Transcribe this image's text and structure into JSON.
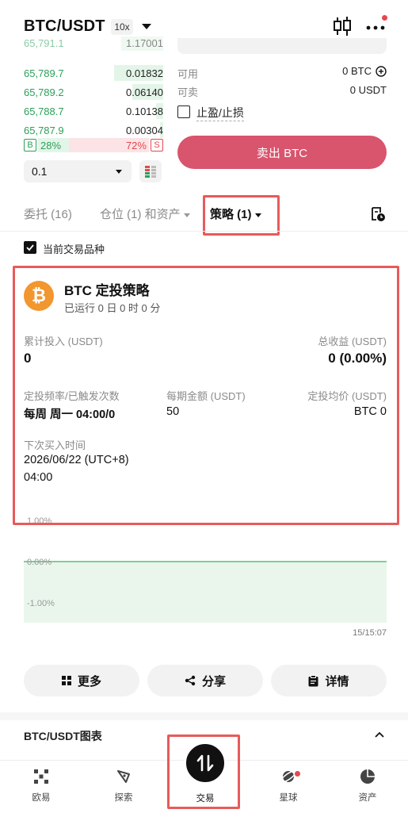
{
  "header": {
    "pair": "BTC/USDT",
    "leverage": "10x"
  },
  "orderbook": {
    "rows": [
      {
        "price": "65,791.1",
        "qty": "1.17001",
        "depth": 0.3
      },
      {
        "price": "65,789.7",
        "qty": "0.01832",
        "depth": 0.35
      },
      {
        "price": "65,789.2",
        "qty": "0.06140",
        "depth": 0.22
      },
      {
        "price": "65,788.7",
        "qty": "0.10138",
        "depth": 0.05
      },
      {
        "price": "65,787.9",
        "qty": "0.00304",
        "depth": 0.02
      }
    ],
    "buy_label": "B",
    "buy_pct": "28%",
    "sell_pct": "72%",
    "sell_label": "S",
    "buy_ratio": 0.28,
    "qty_step": "0.1"
  },
  "order_form": {
    "available_label": "可用",
    "available_value": "0 BTC",
    "sellable_label": "可卖",
    "sellable_value": "0 USDT",
    "tpsl_label": "止盈/止损",
    "sell_button": "卖出 BTC"
  },
  "tabs": [
    {
      "label": "委托 (16)"
    },
    {
      "label": "仓位 (1) 和资产"
    },
    {
      "label": "策略 (1)"
    }
  ],
  "filter": {
    "current_pair_label": "当前交易品种",
    "checked": true
  },
  "strategy": {
    "coin_symbol": "₿",
    "title": "BTC 定投策略",
    "running": "已运行 0 日 0 时 0 分",
    "invested_label": "累计投入 (USDT)",
    "invested_value": "0",
    "pnl_label": "总收益 (USDT)",
    "pnl_value": "0 (0.00%)",
    "freq_label": "定投频率/已触发次数",
    "freq_value": "每周 周一 04:00/0",
    "amount_label": "每期金额 (USDT)",
    "amount_value": "50",
    "avg_label": "定投均价 (USDT)",
    "avg_value": "BTC 0",
    "next_label": "下次买入时间",
    "next_date": "2026/06/22 (UTC+8)",
    "next_time": "04:00"
  },
  "chart_data": {
    "type": "area",
    "y_tick_labels": [
      "1.00%",
      "0.00%",
      "-1.00%"
    ],
    "ylim": [
      -1.0,
      1.0
    ],
    "x_label_right": "15/15:07",
    "series": [
      {
        "x": [
          0,
          1
        ],
        "values": [
          0.0,
          0.0
        ]
      }
    ],
    "color": "#5cbf75"
  },
  "actions": {
    "more": "更多",
    "share": "分享",
    "details": "详情"
  },
  "chart_section": {
    "title": "BTC/USDT图表"
  },
  "nav": {
    "items": [
      {
        "label": "欧易"
      },
      {
        "label": "探索"
      },
      {
        "label": "交易"
      },
      {
        "label": "星球"
      },
      {
        "label": "资产"
      }
    ]
  },
  "colors": {
    "buy": "#2ca05a",
    "sell": "#d9546d",
    "highlight": "#e85a5a",
    "coin": "#f2962e"
  }
}
